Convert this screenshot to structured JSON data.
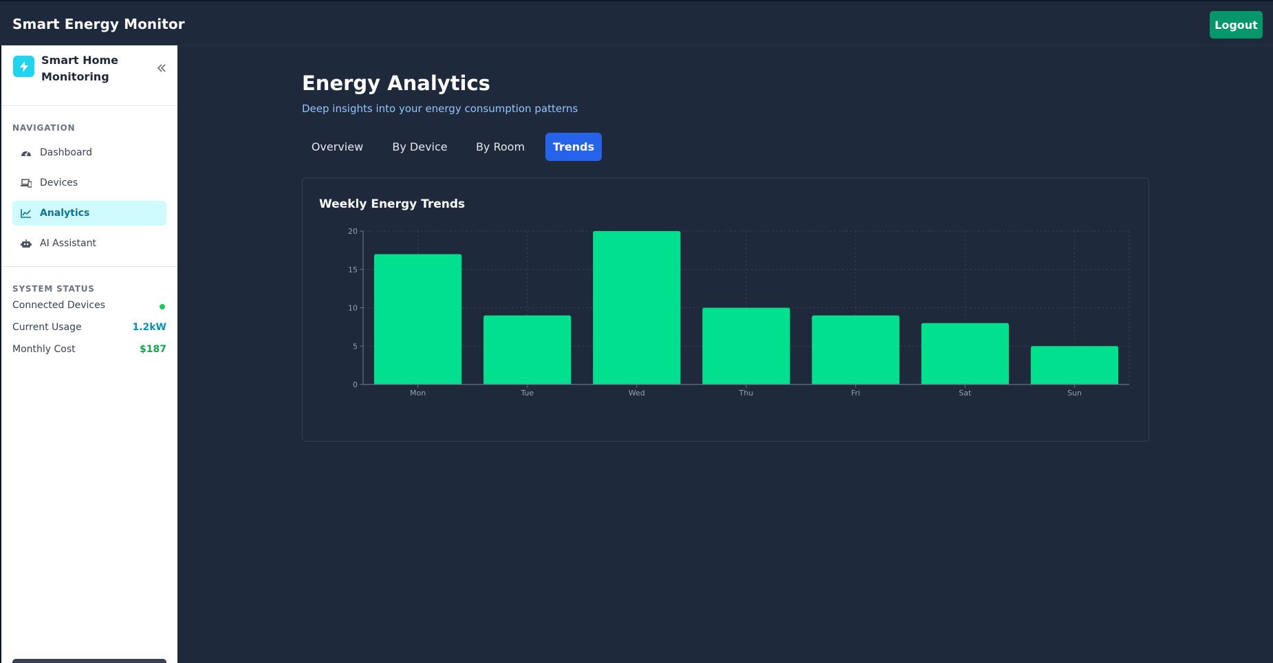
{
  "header": {
    "app_title": "Smart Energy Monitor",
    "logout_label": "Logout"
  },
  "sidebar": {
    "brand": "Smart Home Monitoring",
    "collapse_icon": "chevrons-left-icon",
    "nav_section_label": "NAVIGATION",
    "items": [
      {
        "label": "Dashboard",
        "icon": "gauge-icon",
        "active": false
      },
      {
        "label": "Devices",
        "icon": "devices-icon",
        "active": false
      },
      {
        "label": "Analytics",
        "icon": "chart-line-icon",
        "active": true
      },
      {
        "label": "AI Assistant",
        "icon": "robot-icon",
        "active": false
      }
    ],
    "status_section_label": "SYSTEM STATUS",
    "status": [
      {
        "label": "Connected Devices",
        "indicator": "online",
        "color": "#22c55e"
      },
      {
        "label": "Current Usage",
        "value": "1.2kW",
        "color": "#0891b2"
      },
      {
        "label": "Monthly Cost",
        "value": "$187",
        "color": "#16a34a"
      }
    ]
  },
  "main": {
    "title": "Energy Analytics",
    "subtitle": "Deep insights into your energy consumption patterns",
    "tabs": [
      {
        "label": "Overview",
        "active": false
      },
      {
        "label": "By Device",
        "active": false
      },
      {
        "label": "By Room",
        "active": false
      },
      {
        "label": "Trends",
        "active": true
      }
    ]
  },
  "chart_data": {
    "type": "bar",
    "title": "Weekly Energy Trends",
    "categories": [
      "Mon",
      "Tue",
      "Wed",
      "Thu",
      "Fri",
      "Sat",
      "Sun"
    ],
    "values": [
      17,
      9,
      20,
      10,
      9,
      8,
      5
    ],
    "yticks": [
      0,
      5,
      10,
      15,
      20
    ],
    "ylim": [
      0,
      20
    ],
    "grid": true,
    "bar_color": "#00e08e"
  },
  "colors": {
    "accent": "#2563eb",
    "logout": "#059669",
    "background": "#1e293b"
  }
}
